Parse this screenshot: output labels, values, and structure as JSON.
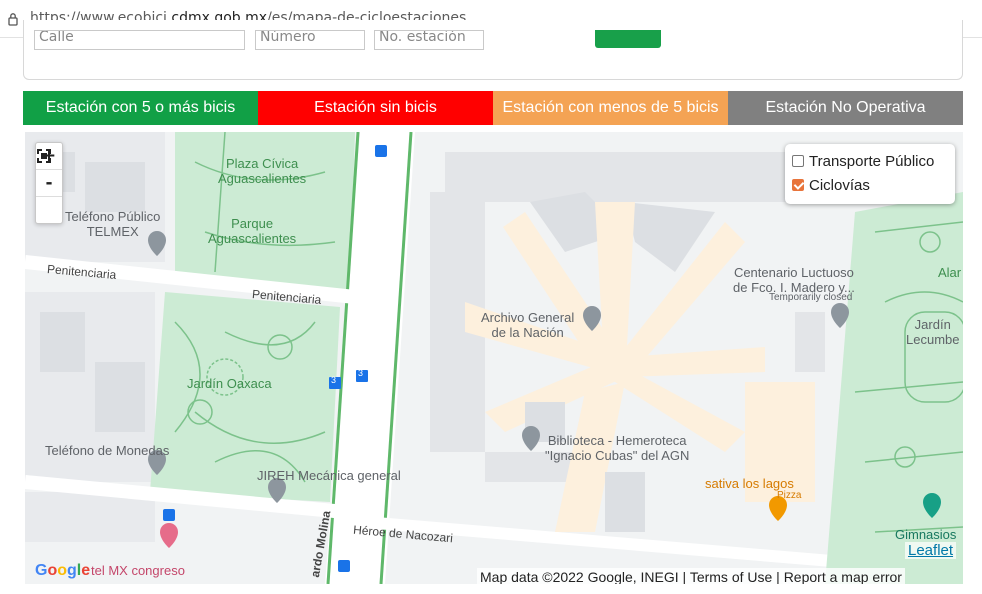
{
  "browser": {
    "url_prefix": "https://www.ecobici.",
    "url_domain": "cdmx.gob.mx",
    "url_path": "/es/mapa-de-cicloestaciones"
  },
  "form": {
    "street_placeholder": "Calle",
    "number_placeholder": "Número",
    "station_placeholder": "No. estación"
  },
  "legend": [
    {
      "label": "Estación con 5 o más bicis",
      "color": "#11a046"
    },
    {
      "label": "Estación sin bicis",
      "color": "#ff0000"
    },
    {
      "label": "Estación con menos de 5 bicis",
      "color": "#f4a354"
    },
    {
      "label": "Estación No Operativa",
      "color": "#808080"
    }
  ],
  "map": {
    "zoom_in": "+",
    "zoom_out": "-",
    "layers": {
      "transport": "Transporte Público",
      "bike_lanes": "Ciclovías",
      "transport_checked": false,
      "bike_lanes_checked": true
    },
    "labels": {
      "plaza_1": "Plaza Cívica",
      "plaza_2": "Aguascalientes",
      "parque_1": "Parque",
      "parque_2": "Aguascalientes",
      "tel_telmex_1": "Teléfono Público",
      "tel_telmex_2": "TELMEX",
      "penitenciaria_1": "Penitenciaria",
      "penitenciaria_2": "Penitenciaria",
      "jardin_oaxaca": "Jardín Oaxaca",
      "tel_monedas": "Teléfono de Monedas",
      "jireh": "JIREH Mecánica general",
      "archivo_1": "Archivo General",
      "archivo_2": "de la Nación",
      "biblioteca_1": "Biblioteca - Hemeroteca",
      "biblioteca_2": "\"Ignacio Cubas\" del AGN",
      "centenario_1": "Centenario Luctuoso",
      "centenario_2": "de Fco. I. Madero y...",
      "temp_closed": "Temporarily closed",
      "jardin_lecumberri_1": "Jardín",
      "jardin_lecumberri_2": "Lecumbe",
      "alam": "Alar",
      "sativa": "sativa los lagos",
      "pizza": "Pizza",
      "heroe": "Héroe de Nacozari",
      "molina": "ardo Molina",
      "gimnasio": "Gimnasios",
      "hotel": "tel MX congreso",
      "bus_num": "3"
    },
    "google_logo": [
      "G",
      "o",
      "o",
      "g",
      "l",
      "e"
    ],
    "attribution": "Map data ©2022 Google, INEGI | Terms of Use | Report a map error",
    "leaflet": "Leaflet"
  }
}
